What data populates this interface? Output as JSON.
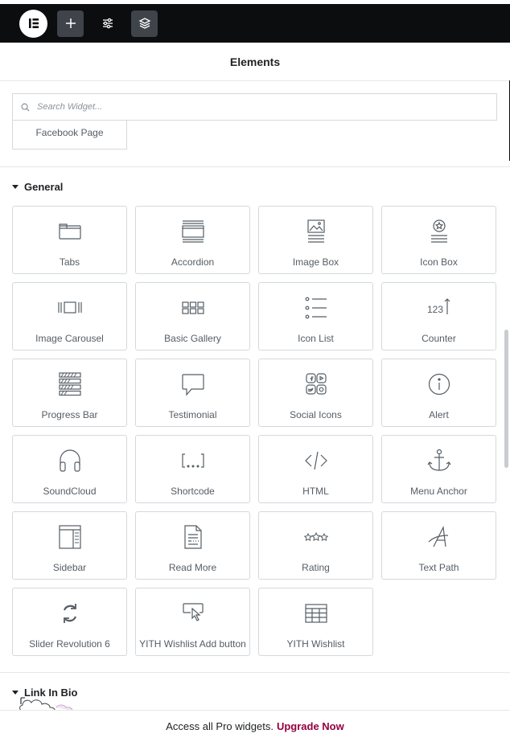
{
  "topbar": {
    "logo_icon": "elementor-logo-icon",
    "add_icon": "plus-icon",
    "settings_icon": "sliders-icon",
    "layers_icon": "layers-icon"
  },
  "header": {
    "title": "Elements"
  },
  "search": {
    "placeholder": "Search Widget..."
  },
  "previous_tile": {
    "label": "Facebook Page"
  },
  "categories": {
    "general": {
      "title": "General"
    },
    "link_in_bio": {
      "title": "Link In Bio"
    }
  },
  "widgets": [
    {
      "label": "Tabs",
      "icon": "tabs-icon"
    },
    {
      "label": "Accordion",
      "icon": "accordion-icon"
    },
    {
      "label": "Image Box",
      "icon": "image-box-icon"
    },
    {
      "label": "Icon Box",
      "icon": "icon-box-icon"
    },
    {
      "label": "Image Carousel",
      "icon": "image-carousel-icon"
    },
    {
      "label": "Basic Gallery",
      "icon": "gallery-icon"
    },
    {
      "label": "Icon List",
      "icon": "icon-list-icon"
    },
    {
      "label": "Counter",
      "icon": "counter-icon"
    },
    {
      "label": "Progress Bar",
      "icon": "progress-bar-icon"
    },
    {
      "label": "Testimonial",
      "icon": "testimonial-icon"
    },
    {
      "label": "Social Icons",
      "icon": "social-icons-icon"
    },
    {
      "label": "Alert",
      "icon": "alert-icon"
    },
    {
      "label": "SoundCloud",
      "icon": "headphones-icon"
    },
    {
      "label": "Shortcode",
      "icon": "shortcode-icon"
    },
    {
      "label": "HTML",
      "icon": "code-icon"
    },
    {
      "label": "Menu Anchor",
      "icon": "anchor-icon"
    },
    {
      "label": "Sidebar",
      "icon": "sidebar-icon"
    },
    {
      "label": "Read More",
      "icon": "read-more-icon"
    },
    {
      "label": "Rating",
      "icon": "rating-icon"
    },
    {
      "label": "Text Path",
      "icon": "text-path-icon"
    },
    {
      "label": "Slider Revolution 6",
      "icon": "refresh-icon"
    },
    {
      "label": "YITH Wishlist Add button",
      "icon": "pointer-click-icon"
    },
    {
      "label": "YITH Wishlist",
      "icon": "table-icon"
    }
  ],
  "footer": {
    "text": "Access all Pro widgets.",
    "link": "Upgrade Now"
  },
  "colors": {
    "topbar": "#0c0d0e",
    "accent": "#93003f",
    "border": "#d5d8dc",
    "text": "#555d65"
  }
}
